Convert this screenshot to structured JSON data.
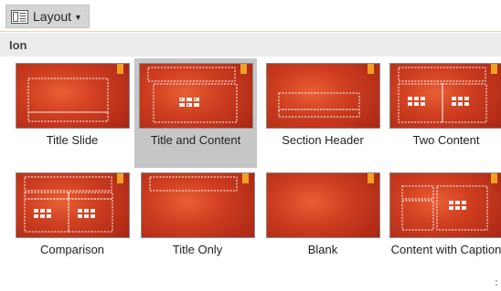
{
  "toolbar": {
    "layout_label": "Layout",
    "layout_icon": "slide-layout-icon",
    "dropdown_icon": "chevron-down-icon"
  },
  "theme": {
    "name": "Ion"
  },
  "layouts": [
    {
      "label": "Title Slide",
      "selected": false
    },
    {
      "label": "Title and Content",
      "selected": true
    },
    {
      "label": "Section Header",
      "selected": false
    },
    {
      "label": "Two Content",
      "selected": false
    },
    {
      "label": "Comparison",
      "selected": false
    },
    {
      "label": "Title Only",
      "selected": false
    },
    {
      "label": "Blank",
      "selected": false
    },
    {
      "label": "Content with Caption",
      "selected": false
    }
  ],
  "colors": {
    "slide_red": "#cf3e20",
    "accent_orange": "#f1a020",
    "selection": "#c6c6c6"
  }
}
